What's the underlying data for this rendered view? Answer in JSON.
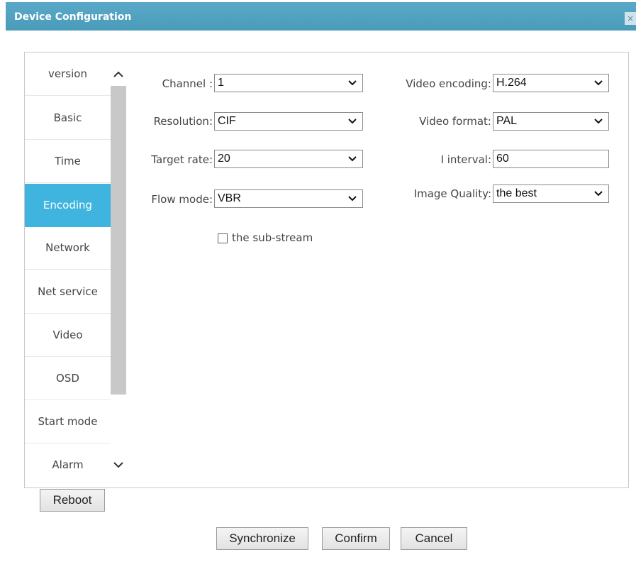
{
  "dialog": {
    "title": "Device Configuration",
    "close_glyph": "×"
  },
  "nav": {
    "items": [
      {
        "label": "version"
      },
      {
        "label": "Basic"
      },
      {
        "label": "Time"
      },
      {
        "label": "Encoding",
        "active": true
      },
      {
        "label": "Network"
      },
      {
        "label": "Net service"
      },
      {
        "label": "Video"
      },
      {
        "label": "OSD"
      },
      {
        "label": "Start mode"
      },
      {
        "label": "Alarm"
      }
    ],
    "scroll_up_icon": "chevron-up-icon",
    "scroll_down_icon": "chevron-down-icon"
  },
  "encoding": {
    "channel": {
      "label": "Channel :",
      "value": "1"
    },
    "resolution": {
      "label": "Resolution:",
      "value": "CIF"
    },
    "target_rate": {
      "label": "Target rate:",
      "value": "20"
    },
    "flow_mode": {
      "label": "Flow mode:",
      "value": "VBR"
    },
    "video_encoding": {
      "label": "Video encoding:",
      "value": "H.264"
    },
    "video_format": {
      "label": "Video format:",
      "value": "PAL"
    },
    "i_interval": {
      "label": "I interval:",
      "value": "60"
    },
    "image_quality": {
      "label": "Image Quality:",
      "value": "the best"
    },
    "sub_stream": {
      "label": "the sub-stream",
      "checked": false
    }
  },
  "buttons": {
    "reboot": "Reboot",
    "synchronize": "Synchronize",
    "confirm": "Confirm",
    "cancel": "Cancel"
  },
  "colors": {
    "titlebar": "#4a9ab9",
    "active_nav": "#3fb4de"
  }
}
